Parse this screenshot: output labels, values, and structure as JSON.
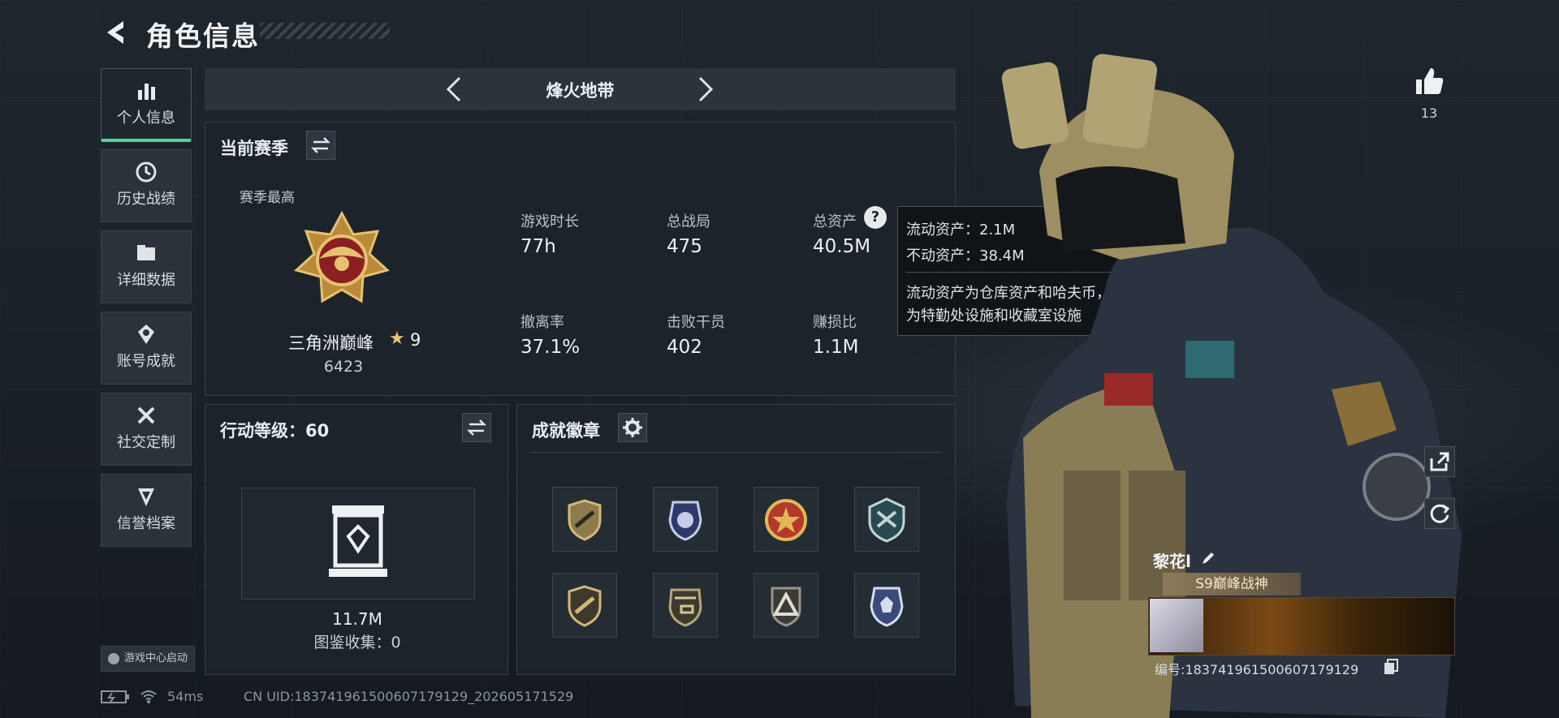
{
  "header": {
    "title": "角色信息"
  },
  "sidebar": {
    "items": [
      {
        "label": "个人信息",
        "icon": "bar-chart-icon",
        "active": true
      },
      {
        "label": "历史战绩",
        "icon": "clock-icon"
      },
      {
        "label": "详细数据",
        "icon": "folder-icon"
      },
      {
        "label": "账号成就",
        "icon": "achievement-icon"
      },
      {
        "label": "社交定制",
        "icon": "tools-icon"
      },
      {
        "label": "信誉档案",
        "icon": "reputation-icon"
      }
    ],
    "launch_label": "游戏中心启动"
  },
  "nav": {
    "mode_title": "烽火地带"
  },
  "season": {
    "title": "当前赛季",
    "best_label": "赛季最高",
    "rank_name": "三角洲巅峰",
    "rank_stars": "9",
    "rank_score": "6423",
    "stats": [
      {
        "label": "游戏时长",
        "value": "77h"
      },
      {
        "label": "总战局",
        "value": "475"
      },
      {
        "label": "总资产",
        "value": "40.5M"
      },
      {
        "label": "撤离率",
        "value": "37.1%"
      },
      {
        "label": "击败干员",
        "value": "402"
      },
      {
        "label": "赚损比",
        "value": "1.1M"
      }
    ]
  },
  "tooltip": {
    "liquid": "流动资产：2.1M",
    "fixed": "不动资产：38.4M",
    "desc_line1": "流动资产为仓库资产和哈夫币，不动资产",
    "desc_line2": "为特勤处设施和收藏室设施"
  },
  "action_level": {
    "title": "行动等级：60",
    "value": "11.7M",
    "collection": "图鉴收集：0"
  },
  "achievements": {
    "title": "成就徽章",
    "badges": [
      "badge-gun-shield",
      "badge-police-star",
      "badge-red-star",
      "badge-helmet-shield",
      "badge-gun-shield-2",
      "badge-helicopter",
      "badge-triangle",
      "badge-police-star-2"
    ]
  },
  "profile": {
    "likes": "13",
    "name": "黎花l",
    "title_badge": "S9巅峰战神",
    "uid_line": "编号:1837419615006071791​29"
  },
  "status_bar": {
    "ping": "54ms",
    "uid_full": "CN UID:183741961500607179129_202605171529"
  },
  "colors": {
    "accent": "#51d39f",
    "panel": "#1d242b",
    "text": "#d9dee3"
  }
}
